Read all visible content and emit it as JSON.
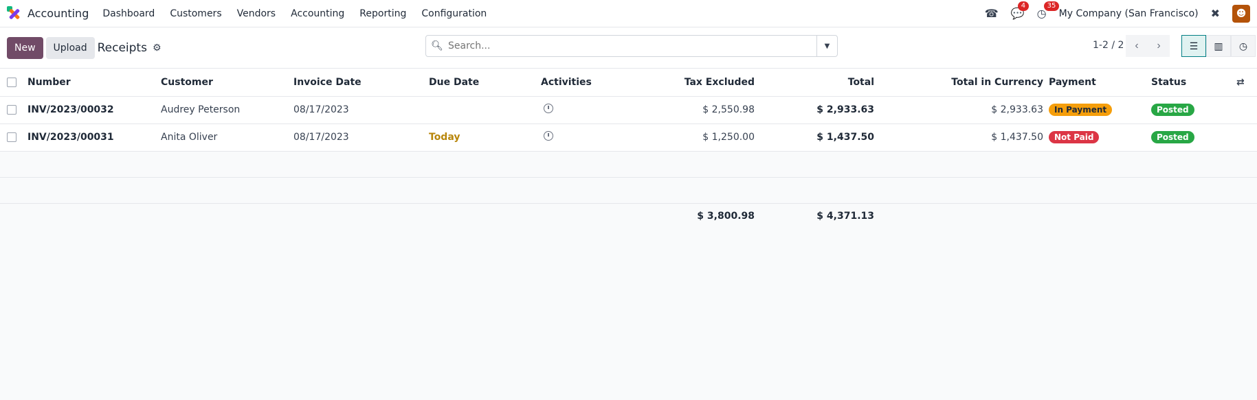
{
  "app": {
    "name": "Accounting"
  },
  "menu": [
    "Dashboard",
    "Customers",
    "Vendors",
    "Accounting",
    "Reporting",
    "Configuration"
  ],
  "nav": {
    "messages_count": "4",
    "activities_count": "35",
    "company": "My Company (San Francisco)"
  },
  "control": {
    "new_label": "New",
    "upload_label": "Upload",
    "title": "Receipts",
    "search_placeholder": "Search...",
    "pager": "1-2 / 2"
  },
  "columns": {
    "number": "Number",
    "customer": "Customer",
    "invoice_date": "Invoice Date",
    "due_date": "Due Date",
    "activities": "Activities",
    "tax_excluded": "Tax Excluded",
    "total": "Total",
    "total_currency": "Total in Currency",
    "payment": "Payment",
    "status": "Status"
  },
  "rows": [
    {
      "number": "INV/2023/00032",
      "customer": "Audrey Peterson",
      "invoice_date": "08/17/2023",
      "due_date": "",
      "tax_excluded": "$ 2,550.98",
      "total": "$ 2,933.63",
      "total_currency": "$ 2,933.63",
      "payment": "In Payment",
      "status": "Posted"
    },
    {
      "number": "INV/2023/00031",
      "customer": "Anita Oliver",
      "invoice_date": "08/17/2023",
      "due_date": "Today",
      "tax_excluded": "$ 1,250.00",
      "total": "$ 1,437.50",
      "total_currency": "$ 1,437.50",
      "payment": "Not Paid",
      "status": "Posted"
    }
  ],
  "totals": {
    "tax_excluded": "$ 3,800.98",
    "total": "$ 4,371.13"
  },
  "colors": {
    "brand": "#714b67",
    "in_payment": "#f59e0b",
    "not_paid": "#dc3545",
    "posted": "#28a745",
    "today": "#b8860b"
  }
}
